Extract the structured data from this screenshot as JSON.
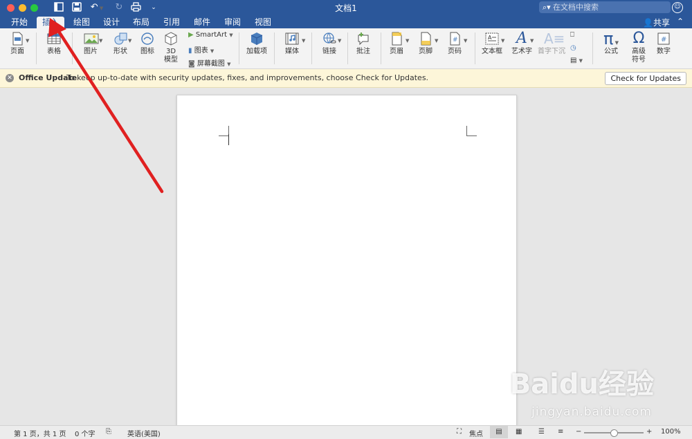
{
  "window": {
    "title": "文档1",
    "search_placeholder": "在文档中搜索"
  },
  "tabs": [
    {
      "label": "开始"
    },
    {
      "label": "插入"
    },
    {
      "label": "绘图"
    },
    {
      "label": "设计"
    },
    {
      "label": "布局"
    },
    {
      "label": "引用"
    },
    {
      "label": "邮件"
    },
    {
      "label": "审阅"
    },
    {
      "label": "视图"
    }
  ],
  "share_label": "共享",
  "ribbon": {
    "page": "页面",
    "table": "表格",
    "picture": "图片",
    "shape": "形状",
    "icon": "图标",
    "model3d": "3D\n模型",
    "smartart": "SmartArt",
    "chart": "图表",
    "screenshot": "屏幕截图",
    "addins": "加载项",
    "media": "媒体",
    "link": "链接",
    "comment": "批注",
    "header": "页眉",
    "footer": "页脚",
    "pagenum": "页码",
    "textbox": "文本框",
    "wordart": "艺术字",
    "dropcap": "首字下沉",
    "equation": "公式",
    "symbol": "高级\n符号",
    "number": "数字"
  },
  "notice": {
    "title": "Office Update",
    "message": "To keep up-to-date with security updates, fixes, and improvements, choose Check for Updates.",
    "button": "Check for Updates"
  },
  "status": {
    "page": "第 1 页，共 1 页",
    "words": "0 个字",
    "language": "英语(美国)",
    "focus": "焦点",
    "zoom": "100%"
  },
  "watermark": {
    "brand": "Baidu经验",
    "url": "jingyan.baidu.com"
  },
  "colors": {
    "accent": "#2b579a",
    "arrow": "#e02020",
    "notice_bg": "#fdf6d9"
  }
}
